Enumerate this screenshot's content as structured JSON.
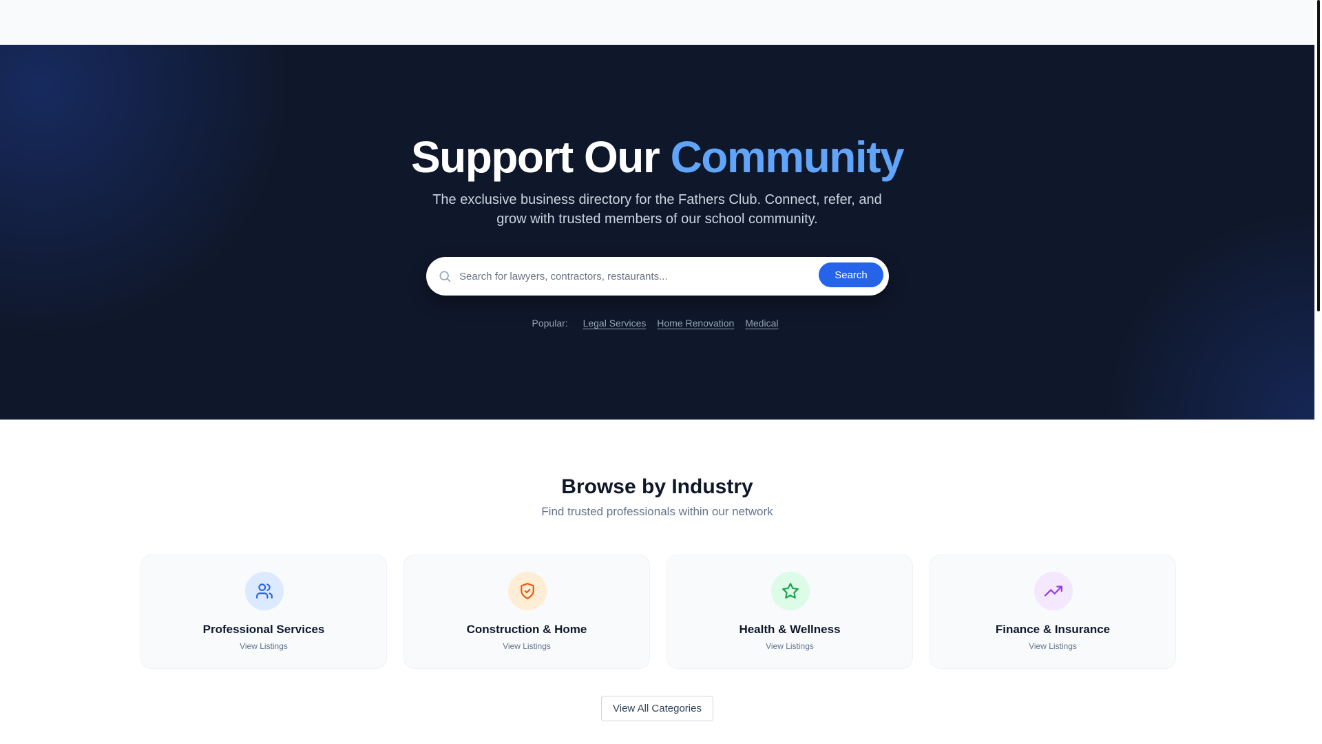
{
  "hero": {
    "title_main": "Support Our",
    "title_accent": "Community",
    "subtitle": "The exclusive business directory for the Fathers Club. Connect, refer, and grow with trusted members of our school community.",
    "accent_color": "#60a5fa",
    "background_color": "#0f172a"
  },
  "search": {
    "placeholder": "Search for lawyers, contractors, restaurants...",
    "value": "",
    "button_label": "Search",
    "icon": "search-icon",
    "button_color": "#2563eb"
  },
  "popular": {
    "label": "Popular:",
    "links": [
      "Legal Services",
      "Home Renovation",
      "Medical"
    ]
  },
  "browse": {
    "title": "Browse by Industry",
    "subtitle": "Find trusted professionals within our network"
  },
  "categories": [
    {
      "title": "Professional Services",
      "link": "View Listings",
      "icon": "users-icon",
      "icon_color": "#2563eb",
      "icon_bg": "#dbeafe"
    },
    {
      "title": "Construction & Home",
      "link": "View Listings",
      "icon": "shield-check-icon",
      "icon_color": "#ea580c",
      "icon_bg": "#ffedd5"
    },
    {
      "title": "Health & Wellness",
      "link": "View Listings",
      "icon": "star-icon",
      "icon_color": "#16a34a",
      "icon_bg": "#dcfce7"
    },
    {
      "title": "Finance & Insurance",
      "link": "View Listings",
      "icon": "trending-up-icon",
      "icon_color": "#9333ea",
      "icon_bg": "#f3e8ff"
    }
  ],
  "view_all": {
    "label": "View All Categories"
  }
}
